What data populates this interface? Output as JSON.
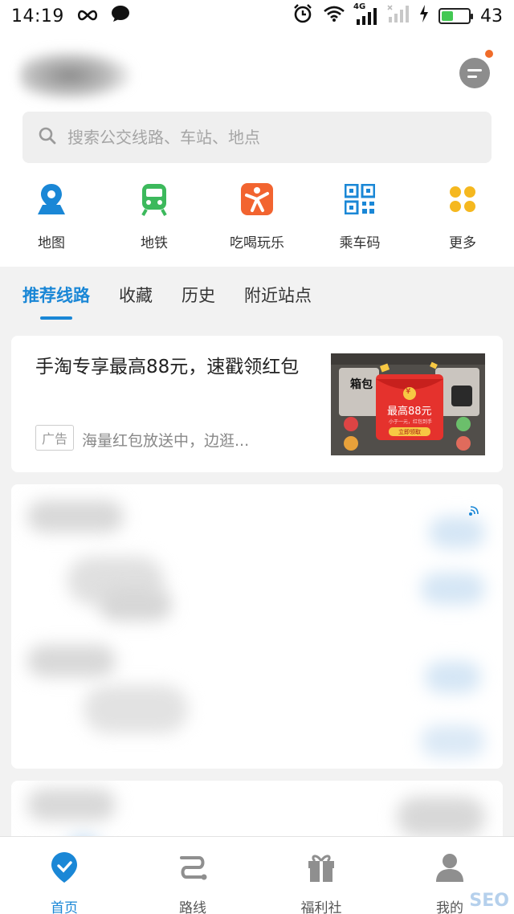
{
  "status_bar": {
    "time": "14:19",
    "network": "4G",
    "battery_level": "43",
    "battery_fraction": 0.43
  },
  "header": {
    "search_placeholder": "搜索公交线路、车站、地点",
    "icons": {
      "message": "message-icon",
      "search": "search-icon"
    }
  },
  "quick_actions": [
    {
      "label": "地图",
      "icon": "map-pin-icon",
      "color": "#1a87d6"
    },
    {
      "label": "地铁",
      "icon": "subway-icon",
      "color": "#3cb95c"
    },
    {
      "label": "吃喝玩乐",
      "icon": "fun-person-icon",
      "color": "#f26430"
    },
    {
      "label": "乘车码",
      "icon": "qr-code-icon",
      "color": "#1a87d6"
    },
    {
      "label": "更多",
      "icon": "more-dots-icon",
      "color": "#f5b81f"
    }
  ],
  "tabs": [
    {
      "label": "推荐线路",
      "active": true
    },
    {
      "label": "收藏",
      "active": false
    },
    {
      "label": "历史",
      "active": false
    },
    {
      "label": "附近站点",
      "active": false
    }
  ],
  "ad": {
    "title": "手淘专享最高88元，速戳领红包",
    "badge": "广告",
    "description": "海量红包放送中，边逛...",
    "image": {
      "header_text": "箱包",
      "amount_text": "最高88元",
      "sub_text": "小于一元，红包到手",
      "button_text": "立即领取",
      "yen": "¥"
    }
  },
  "bottom_nav": [
    {
      "label": "首页",
      "icon": "home-heart-icon",
      "active": true
    },
    {
      "label": "路线",
      "icon": "route-icon",
      "active": false
    },
    {
      "label": "福利社",
      "icon": "gift-icon",
      "active": false
    },
    {
      "label": "我的",
      "icon": "user-icon",
      "active": false
    }
  ],
  "watermark": "SEO",
  "colors": {
    "accent": "#1a87d6",
    "notification_dot": "#f06c2a",
    "battery": "#43c853"
  }
}
